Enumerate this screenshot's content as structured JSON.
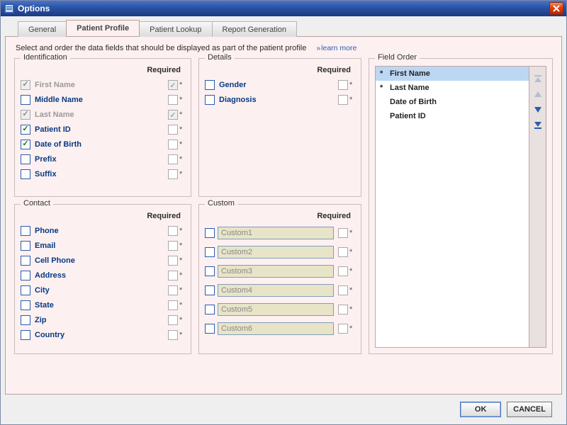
{
  "window": {
    "title": "Options"
  },
  "tabs": [
    "General",
    "Patient Profile",
    "Patient Lookup",
    "Report Generation"
  ],
  "active_tab": 1,
  "instruction": "Select and order the data fields that should be displayed as part of the patient profile",
  "learn_more": "learn more",
  "required_label": "Required",
  "groups": {
    "identification": {
      "legend": "Identification",
      "rows": [
        {
          "label": "First Name",
          "checked": true,
          "req": true,
          "disabled": true
        },
        {
          "label": "Middle Name",
          "checked": false,
          "req": false,
          "disabled": false
        },
        {
          "label": "Last Name",
          "checked": true,
          "req": true,
          "disabled": true
        },
        {
          "label": "Patient ID",
          "checked": true,
          "req": false,
          "disabled": false
        },
        {
          "label": "Date of Birth",
          "checked": true,
          "req": false,
          "disabled": false
        },
        {
          "label": "Prefix",
          "checked": false,
          "req": false,
          "disabled": false
        },
        {
          "label": "Suffix",
          "checked": false,
          "req": false,
          "disabled": false
        }
      ]
    },
    "details": {
      "legend": "Details",
      "rows": [
        {
          "label": "Gender",
          "checked": false,
          "req": false,
          "disabled": false
        },
        {
          "label": "Diagnosis",
          "checked": false,
          "req": false,
          "disabled": false
        }
      ]
    },
    "contact": {
      "legend": "Contact",
      "rows": [
        {
          "label": "Phone",
          "checked": false,
          "req": false,
          "disabled": false
        },
        {
          "label": "Email",
          "checked": false,
          "req": false,
          "disabled": false
        },
        {
          "label": "Cell Phone",
          "checked": false,
          "req": false,
          "disabled": false
        },
        {
          "label": "Address",
          "checked": false,
          "req": false,
          "disabled": false
        },
        {
          "label": "City",
          "checked": false,
          "req": false,
          "disabled": false
        },
        {
          "label": "State",
          "checked": false,
          "req": false,
          "disabled": false
        },
        {
          "label": "Zip",
          "checked": false,
          "req": false,
          "disabled": false
        },
        {
          "label": "Country",
          "checked": false,
          "req": false,
          "disabled": false
        }
      ]
    },
    "custom": {
      "legend": "Custom",
      "rows": [
        {
          "value": "Custom1",
          "checked": false,
          "req": false
        },
        {
          "value": "Custom2",
          "checked": false,
          "req": false
        },
        {
          "value": "Custom3",
          "checked": false,
          "req": false
        },
        {
          "value": "Custom4",
          "checked": false,
          "req": false
        },
        {
          "value": "Custom5",
          "checked": false,
          "req": false
        },
        {
          "value": "Custom6",
          "checked": false,
          "req": false
        }
      ]
    },
    "field_order": {
      "legend": "Field Order",
      "items": [
        {
          "label": "First Name",
          "required": true,
          "selected": true
        },
        {
          "label": "Last Name",
          "required": true,
          "selected": false
        },
        {
          "label": "Date of Birth",
          "required": false,
          "selected": false
        },
        {
          "label": "Patient ID",
          "required": false,
          "selected": false
        }
      ]
    }
  },
  "buttons": {
    "ok": "OK",
    "cancel": "CANCEL"
  }
}
